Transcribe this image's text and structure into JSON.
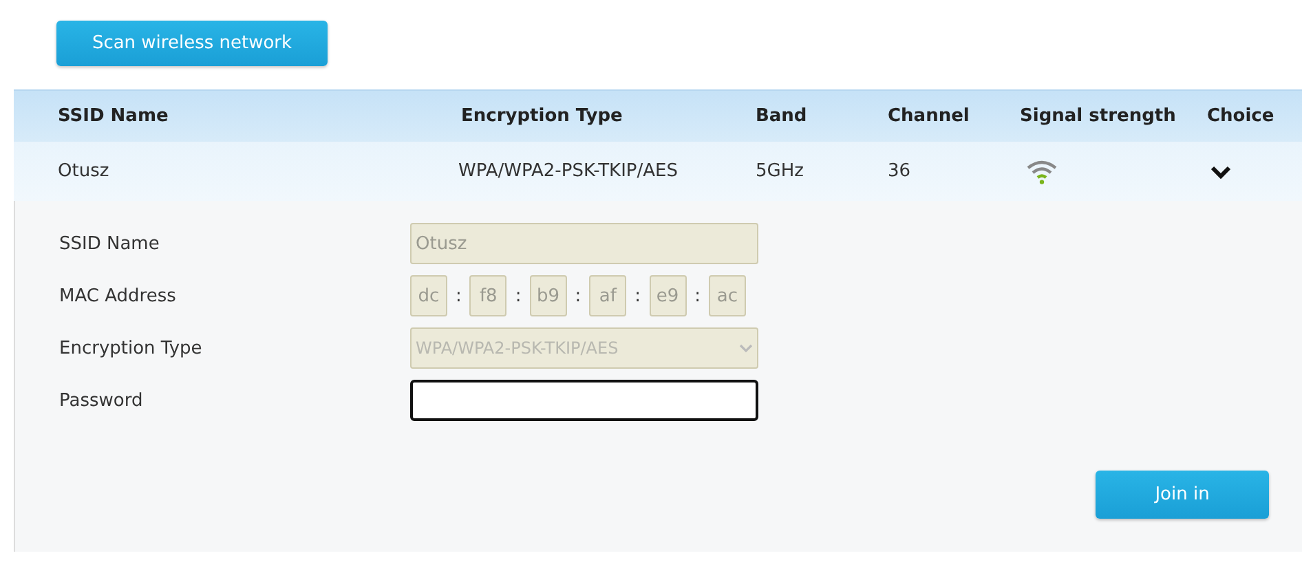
{
  "scan_button": {
    "label": "Scan wireless network"
  },
  "table": {
    "columns": [
      "SSID Name",
      "Encryption Type",
      "Band",
      "Channel",
      "Signal strength",
      "Choice"
    ],
    "rows": [
      {
        "ssid": "Otusz",
        "encryption": "WPA/WPA2-PSK-TKIP/AES",
        "band": "5GHz",
        "channel": "36",
        "expanded": true
      }
    ]
  },
  "details": {
    "fields": [
      {
        "kind": "text",
        "label": "SSID Name",
        "value": "Otusz",
        "disabled": true
      },
      {
        "kind": "mac",
        "label": "MAC Address",
        "parts": [
          "dc",
          "f8",
          "b9",
          "af",
          "e9",
          "ac"
        ],
        "separator": ":",
        "disabled": true
      },
      {
        "kind": "select",
        "label": "Encryption Type",
        "value": "WPA/WPA2-PSK-TKIP/AES",
        "disabled": true
      },
      {
        "kind": "password",
        "label": "Password",
        "disabled": false,
        "focused": true
      }
    ],
    "join_button": {
      "label": "Join in"
    }
  }
}
